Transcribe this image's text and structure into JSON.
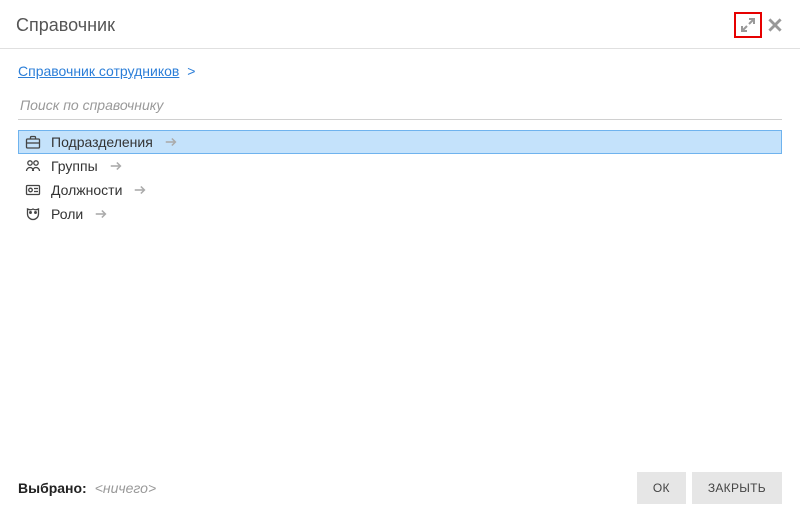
{
  "header": {
    "title": "Справочник"
  },
  "breadcrumb": {
    "link": "Справочник сотрудников",
    "separator": ">"
  },
  "search": {
    "placeholder": "Поиск по справочнику"
  },
  "tree": {
    "items": [
      {
        "label": "Подразделения",
        "icon": "briefcase-icon",
        "selected": true
      },
      {
        "label": "Группы",
        "icon": "people-icon",
        "selected": false
      },
      {
        "label": "Должности",
        "icon": "badge-icon",
        "selected": false
      },
      {
        "label": "Роли",
        "icon": "mask-icon",
        "selected": false
      }
    ]
  },
  "footer": {
    "selected_label": "Выбрано:",
    "selected_value": "<ничего>",
    "ok": "ОК",
    "close": "ЗАКРЫТЬ"
  },
  "colors": {
    "highlight_border": "#e60000",
    "link": "#2b7ed8",
    "selection_bg": "#c4e2fb",
    "selection_border": "#6fb3ee"
  }
}
